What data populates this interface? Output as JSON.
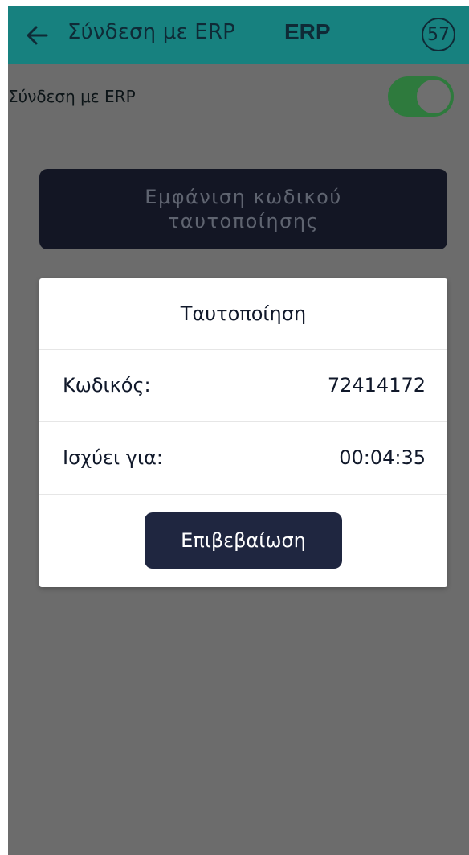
{
  "header": {
    "title": "Σύνδεση με ERP",
    "app_label": "ERP",
    "timer": "57",
    "back_icon": "arrow-left-icon",
    "color": "#17817f"
  },
  "settings": {
    "erp_toggle_label": "Σύνδεση με ERP",
    "erp_toggle_on": true,
    "show_code_button": "Εμφάνιση κωδικού ταυτοποίησης"
  },
  "dialog": {
    "title": "Ταυτοποίηση",
    "rows": [
      {
        "label": "Κωδικός:",
        "value": "72414172"
      },
      {
        "label": "Ισχύει για:",
        "value": "00:04:35"
      }
    ],
    "confirm_button": "Επιβεβαίωση"
  },
  "colors": {
    "overlay": "#6c6c6c",
    "dark_button": "#131624",
    "confirm_button": "#1f2640",
    "toggle_on": "#2e7a3d"
  }
}
